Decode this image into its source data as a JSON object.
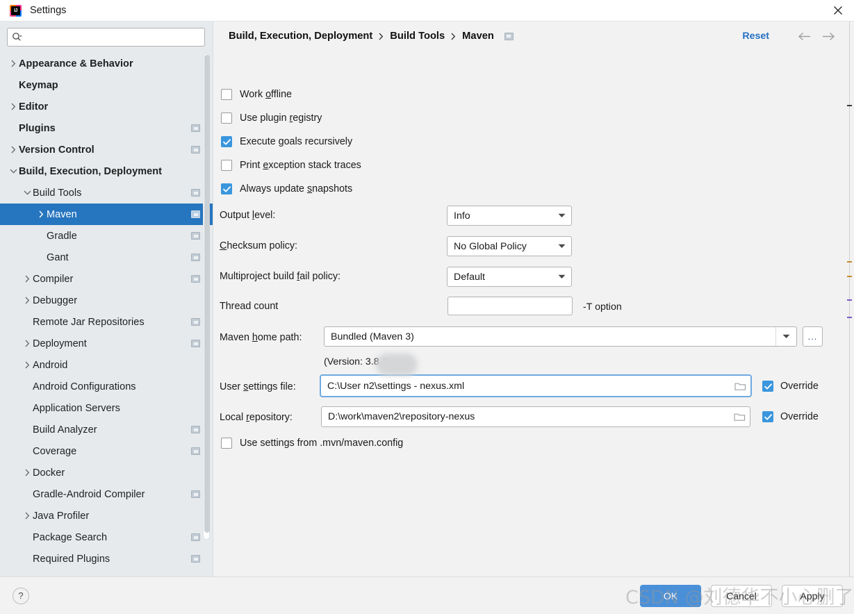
{
  "window": {
    "title": "Settings",
    "logo_text": "IJ",
    "close_icon": "close-icon"
  },
  "sidebar": {
    "search": {
      "value": "",
      "placeholder": ""
    },
    "items": [
      {
        "label": "Appearance & Behavior",
        "indent": 0,
        "arrow": "right",
        "bold": true,
        "badge": false,
        "selected": false
      },
      {
        "label": "Keymap",
        "indent": 0,
        "arrow": "none",
        "bold": true,
        "badge": false,
        "selected": false
      },
      {
        "label": "Editor",
        "indent": 0,
        "arrow": "right",
        "bold": true,
        "badge": false,
        "selected": false
      },
      {
        "label": "Plugins",
        "indent": 0,
        "arrow": "none",
        "bold": true,
        "badge": true,
        "selected": false
      },
      {
        "label": "Version Control",
        "indent": 0,
        "arrow": "right",
        "bold": true,
        "badge": true,
        "selected": false
      },
      {
        "label": "Build, Execution, Deployment",
        "indent": 0,
        "arrow": "down",
        "bold": true,
        "badge": false,
        "selected": false
      },
      {
        "label": "Build Tools",
        "indent": 1,
        "arrow": "down",
        "bold": false,
        "badge": true,
        "selected": false
      },
      {
        "label": "Maven",
        "indent": 2,
        "arrow": "right",
        "bold": false,
        "badge": true,
        "selected": true
      },
      {
        "label": "Gradle",
        "indent": 2,
        "arrow": "none",
        "bold": false,
        "badge": true,
        "selected": false
      },
      {
        "label": "Gant",
        "indent": 2,
        "arrow": "none",
        "bold": false,
        "badge": true,
        "selected": false
      },
      {
        "label": "Compiler",
        "indent": 1,
        "arrow": "right",
        "bold": false,
        "badge": true,
        "selected": false
      },
      {
        "label": "Debugger",
        "indent": 1,
        "arrow": "right",
        "bold": false,
        "badge": false,
        "selected": false
      },
      {
        "label": "Remote Jar Repositories",
        "indent": 1,
        "arrow": "none",
        "bold": false,
        "badge": true,
        "selected": false
      },
      {
        "label": "Deployment",
        "indent": 1,
        "arrow": "right",
        "bold": false,
        "badge": true,
        "selected": false
      },
      {
        "label": "Android",
        "indent": 1,
        "arrow": "right",
        "bold": false,
        "badge": false,
        "selected": false
      },
      {
        "label": "Android Configurations",
        "indent": 1,
        "arrow": "none",
        "bold": false,
        "badge": false,
        "selected": false
      },
      {
        "label": "Application Servers",
        "indent": 1,
        "arrow": "none",
        "bold": false,
        "badge": false,
        "selected": false
      },
      {
        "label": "Build Analyzer",
        "indent": 1,
        "arrow": "none",
        "bold": false,
        "badge": true,
        "selected": false
      },
      {
        "label": "Coverage",
        "indent": 1,
        "arrow": "none",
        "bold": false,
        "badge": true,
        "selected": false
      },
      {
        "label": "Docker",
        "indent": 1,
        "arrow": "right",
        "bold": false,
        "badge": false,
        "selected": false
      },
      {
        "label": "Gradle-Android Compiler",
        "indent": 1,
        "arrow": "none",
        "bold": false,
        "badge": true,
        "selected": false
      },
      {
        "label": "Java Profiler",
        "indent": 1,
        "arrow": "right",
        "bold": false,
        "badge": false,
        "selected": false
      },
      {
        "label": "Package Search",
        "indent": 1,
        "arrow": "none",
        "bold": false,
        "badge": true,
        "selected": false
      },
      {
        "label": "Required Plugins",
        "indent": 1,
        "arrow": "none",
        "bold": false,
        "badge": true,
        "selected": false
      }
    ]
  },
  "breadcrumb": {
    "crumb1": "Build, Execution, Deployment",
    "crumb2": "Build Tools",
    "crumb3": "Maven",
    "reset_label": "Reset",
    "back_icon": "arrow-left-icon",
    "forward_icon": "arrow-right-icon"
  },
  "main": {
    "checkboxes": [
      {
        "label_pre": "Work ",
        "mnemonic": "o",
        "label_post": "ffline",
        "checked": false
      },
      {
        "label_pre": "Use plugin ",
        "mnemonic": "r",
        "label_post": "egistry",
        "checked": false
      },
      {
        "label_pre": "Execute ",
        "mnemonic": "g",
        "label_post": "oals recursively",
        "checked": true
      },
      {
        "label_pre": "Print ",
        "mnemonic": "e",
        "label_post": "xception stack traces",
        "checked": false
      },
      {
        "label_pre": "Always update ",
        "mnemonic": "s",
        "label_post": "napshots",
        "checked": true
      }
    ],
    "output_level": {
      "label_pre": "Output ",
      "mnemonic": "l",
      "label_post": "evel:",
      "value": "Info"
    },
    "checksum_policy": {
      "label_pre": "",
      "mnemonic": "C",
      "label_post": "hecksum policy:",
      "value": "No Global Policy"
    },
    "multiproject_policy": {
      "label_pre": "Multiproject build ",
      "mnemonic": "f",
      "label_post": "ail policy:",
      "value": "Default"
    },
    "thread_count": {
      "label": "Thread count",
      "value": "",
      "hint": "-T option"
    },
    "maven_home": {
      "label_pre": "Maven ",
      "mnemonic": "h",
      "label_post": "ome path:",
      "value": "Bundled (Maven 3)",
      "browse_label": "...",
      "version_note": "(Version: 3.8.1)"
    },
    "user_settings": {
      "label_pre": "User ",
      "mnemonic": "s",
      "label_post": "ettings file:",
      "value": "C:\\User              n2\\settings - nexus.xml",
      "override_label": "Override",
      "override_checked": true
    },
    "local_repository": {
      "label_pre": "Local ",
      "mnemonic": "r",
      "label_post": "epository:",
      "value": "D:\\work\\maven2\\repository-nexus",
      "override_label": "Override",
      "override_checked": true
    },
    "mvn_config": {
      "label": "Use settings from .mvn/maven.config",
      "checked": false
    }
  },
  "footer": {
    "help_label": "?",
    "ok_label": "OK",
    "cancel_label": "Cancel",
    "apply_label": "Apply"
  },
  "watermark": {
    "text": "CSDN @刘德华不小心删了代码"
  },
  "colors": {
    "accent_blue": "#2675bf",
    "checkbox_blue": "#3a96dd",
    "link_blue": "#2470c4",
    "primary_button": "#4a90d9",
    "sidebar_bg": "#e6eaed",
    "pane_bg": "#f2f2f2"
  }
}
